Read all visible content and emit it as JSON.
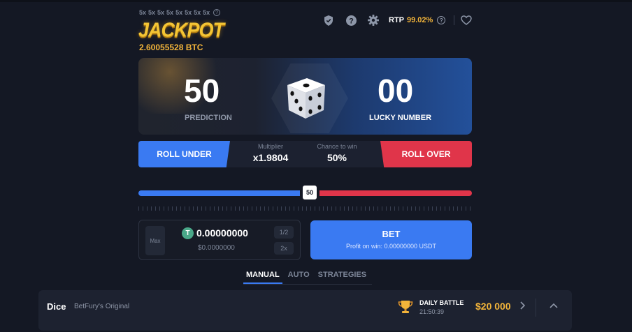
{
  "jackpot": {
    "multipliers": [
      "5x",
      "5x",
      "5x",
      "5x",
      "5x",
      "5x",
      "5x",
      "5x"
    ],
    "title": "JACKPOT",
    "amount": "2.60055528 BTC"
  },
  "toolbar": {
    "icons": [
      "shield-icon",
      "question-icon",
      "gear-icon",
      "heart-icon"
    ],
    "rtp_label": "RTP",
    "rtp_value": "99.02%"
  },
  "result": {
    "prediction": "50",
    "prediction_label": "PREDICTION",
    "lucky_number": "00",
    "lucky_label": "LUCKY NUMBER"
  },
  "controls": {
    "roll_under": "ROLL UNDER",
    "roll_over": "ROLL OVER",
    "multiplier_label": "Multiplier",
    "multiplier_value": "x1.9804",
    "chance_label": "Chance to win",
    "chance_value": "50%"
  },
  "slider": {
    "value": "50",
    "fraction": 0.5
  },
  "bet": {
    "max_label": "Max",
    "amount": "0.00000000",
    "amount_usd": "$0.0000000",
    "half_label": "1/2",
    "double_label": "2x",
    "bet_label": "BET",
    "profit_text": "Profit on win: 0.00000000 USDT",
    "coin_symbol": "T"
  },
  "tabs": [
    {
      "label": "MANUAL",
      "active": true
    },
    {
      "label": "AUTO",
      "active": false
    },
    {
      "label": "STRATEGIES",
      "active": false
    }
  ],
  "footer": {
    "game": "Dice",
    "subtitle": "BetFury's Original",
    "battle_title": "DAILY BATTLE",
    "battle_time": "21:50:39",
    "battle_prize": "$20 000"
  },
  "colors": {
    "background": "#141824",
    "blue": "#3a7af2",
    "red": "#e0354a",
    "gold": "#f2b43a"
  }
}
